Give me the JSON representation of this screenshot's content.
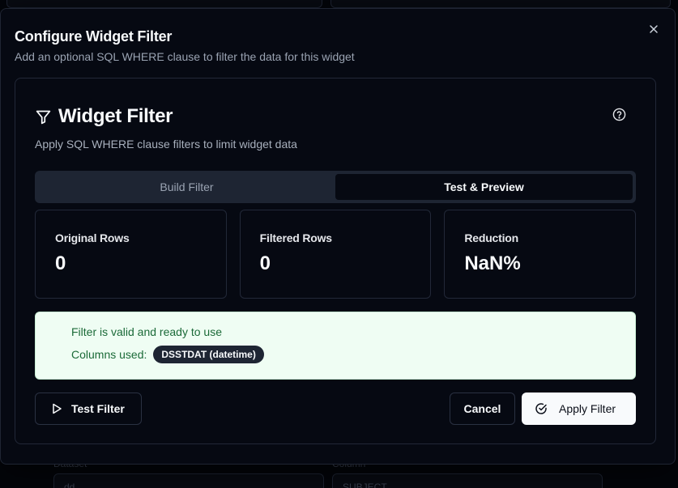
{
  "dialog": {
    "title": "Configure Widget Filter",
    "description": "Add an optional SQL WHERE clause to filter the data for this widget",
    "close_icon": "x-icon"
  },
  "card": {
    "title": "Widget Filter",
    "title_icon": "funnel-icon",
    "help_icon": "question-circle-icon",
    "description": "Apply SQL WHERE clause filters to limit widget data"
  },
  "tabs": [
    {
      "label": "Build Filter",
      "active": false
    },
    {
      "label": "Test & Preview",
      "active": true
    }
  ],
  "stats": [
    {
      "label": "Original Rows",
      "value": "0"
    },
    {
      "label": "Filtered Rows",
      "value": "0"
    },
    {
      "label": "Reduction",
      "value": "NaN%"
    }
  ],
  "validation": {
    "message": "Filter is valid and ready to use",
    "columns_label": "Columns used:",
    "columns": [
      "DSSTDAT (datetime)"
    ]
  },
  "buttons": {
    "test": "Test Filter",
    "cancel": "Cancel",
    "apply": "Apply Filter"
  },
  "background": {
    "field1_label": "Dataset",
    "field1_value": "dd",
    "field2_label": "Column",
    "field2_value": "SUBJECT"
  },
  "colors": {
    "success_bg": "#effdf3",
    "success_text": "#1b6a38",
    "badge_bg": "#1e2533",
    "primary_button_bg": "#f8fafc"
  }
}
